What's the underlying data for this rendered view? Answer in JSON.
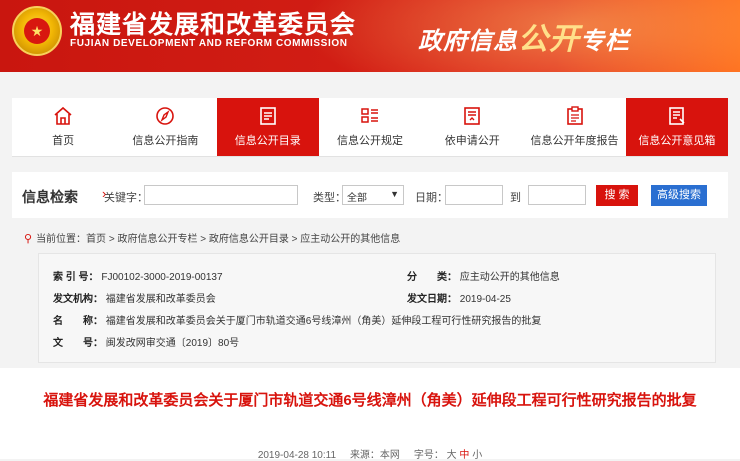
{
  "header": {
    "org_name_cn": "福建省发展和改革委员会",
    "org_name_en": "FUJIAN DEVELOPMENT AND REFORM COMMISSION",
    "column_title_a": "政府信息",
    "column_title_b": "公开",
    "column_title_c": "专栏"
  },
  "nav": {
    "items": [
      {
        "label": "首页",
        "icon": "home-icon"
      },
      {
        "label": "信息公开指南",
        "icon": "compass-icon"
      },
      {
        "label": "信息公开目录",
        "icon": "document-list-icon",
        "active": true
      },
      {
        "label": "信息公开规定",
        "icon": "rules-list-icon"
      },
      {
        "label": "依申请公开",
        "icon": "application-form-icon"
      },
      {
        "label": "信息公开年度报告",
        "icon": "clipboard-icon"
      },
      {
        "label": "信息公开意见箱",
        "icon": "feedback-box-icon"
      }
    ],
    "active_color": "#d8130d"
  },
  "search": {
    "title": "信息检索",
    "keyword_label": "关键字：",
    "keyword_value": "",
    "type_label": "类型：",
    "type_selected": "全部",
    "date_label": "日期：",
    "date_from": "",
    "to_label": "到",
    "date_to": "",
    "search_button": "搜 索",
    "advanced_button": "高级搜索"
  },
  "breadcrumb": {
    "prefix": "当前位置：",
    "path": "首页 > 政府信息公开专栏 > 政府信息公开目录 > 应主动公开的其他信息"
  },
  "meta": {
    "index_label": "索 引 号：",
    "index_value": "FJ00102-3000-2019-00137",
    "category_label": "分　　类：",
    "category_value": "应主动公开的其他信息",
    "issuer_label": "发文机构：",
    "issuer_value": "福建省发展和改革委员会",
    "date_label": "发文日期：",
    "date_value": "2019-04-25",
    "name_label": "名　　称：",
    "name_value": "福建省发展和改革委员会关于厦门市轨道交通6号线漳州（角美）延伸段工程可行性研究报告的批复",
    "docno_label": "文　　号：",
    "docno_value": "闽发改网审交通〔2019〕80号"
  },
  "article": {
    "title": "福建省发展和改革委员会关于厦门市轨道交通6号线漳州（角美）延伸段工程可行性研究报告的批复",
    "datetime": "2019-04-28 10:11",
    "source": "来源：本网",
    "fontsize_label": "字号：",
    "font_large": "大",
    "font_medium": "中",
    "font_small": "小"
  },
  "colors": {
    "brand_red": "#d8130d",
    "adv_blue": "#2a6fd1"
  }
}
